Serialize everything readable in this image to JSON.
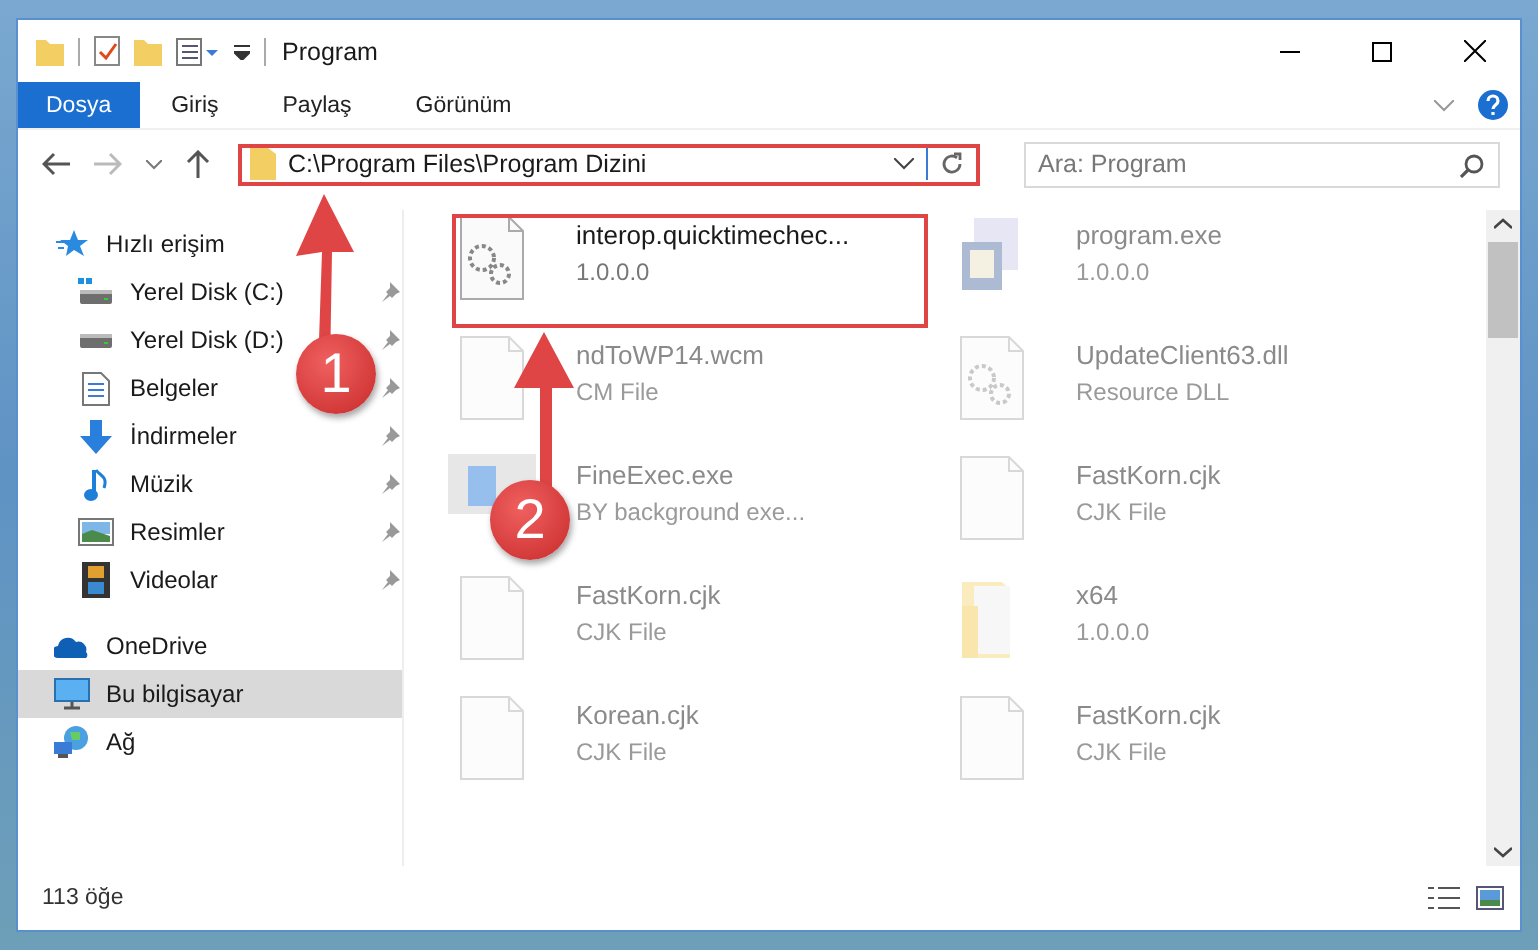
{
  "window": {
    "title": "Program"
  },
  "ribbon_tabs": [
    {
      "label": "Dosya",
      "selected": true
    },
    {
      "label": "Giriş",
      "selected": false
    },
    {
      "label": "Paylaş",
      "selected": false
    },
    {
      "label": "Görünüm",
      "selected": false
    }
  ],
  "address": {
    "path": "C:\\Program Files\\Program Dizini"
  },
  "search": {
    "placeholder": "Ara: Program"
  },
  "sidebar": {
    "items": [
      {
        "label": "Hızlı erişim",
        "selected": false,
        "children": [
          {
            "label": "Yerel Disk (C:)",
            "pinned": true
          },
          {
            "label": "Yerel Disk (D:)",
            "pinned": true
          },
          {
            "label": "Belgeler",
            "pinned": true
          },
          {
            "label": "İndirmeler",
            "pinned": true
          },
          {
            "label": "Müzik",
            "pinned": true
          },
          {
            "label": "Resimler",
            "pinned": true
          },
          {
            "label": "Videolar",
            "pinned": true
          }
        ]
      },
      {
        "label": "OneDrive",
        "selected": false
      },
      {
        "label": "Bu bilgisayar",
        "selected": true
      },
      {
        "label": "Ağ",
        "selected": false
      }
    ]
  },
  "files": [
    {
      "name": "interop.quicktimechec...",
      "detail": "1.0.0.0",
      "dimmed": false
    },
    {
      "name": "program.exe",
      "detail": "1.0.0.0",
      "dimmed": true
    },
    {
      "name": "ndToWP14.wcm",
      "detail": "CM File",
      "dimmed": true
    },
    {
      "name": "UpdateClient63.dll",
      "detail": "Resource DLL",
      "dimmed": true
    },
    {
      "name": "FineExec.exe",
      "detail": "BY background exe...",
      "dimmed": true
    },
    {
      "name": "FastKorn.cjk",
      "detail": "CJK File",
      "dimmed": true
    },
    {
      "name": "FastKorn.cjk",
      "detail": "CJK File",
      "dimmed": true
    },
    {
      "name": "x64",
      "detail": "1.0.0.0",
      "dimmed": true
    },
    {
      "name": "Korean.cjk",
      "detail": "CJK File",
      "dimmed": true
    },
    {
      "name": "FastKorn.cjk",
      "detail": "CJK File",
      "dimmed": true
    }
  ],
  "status_bar": {
    "count": "113 öğe"
  },
  "annotations": [
    {
      "label": "1"
    },
    {
      "label": "2"
    }
  ]
}
